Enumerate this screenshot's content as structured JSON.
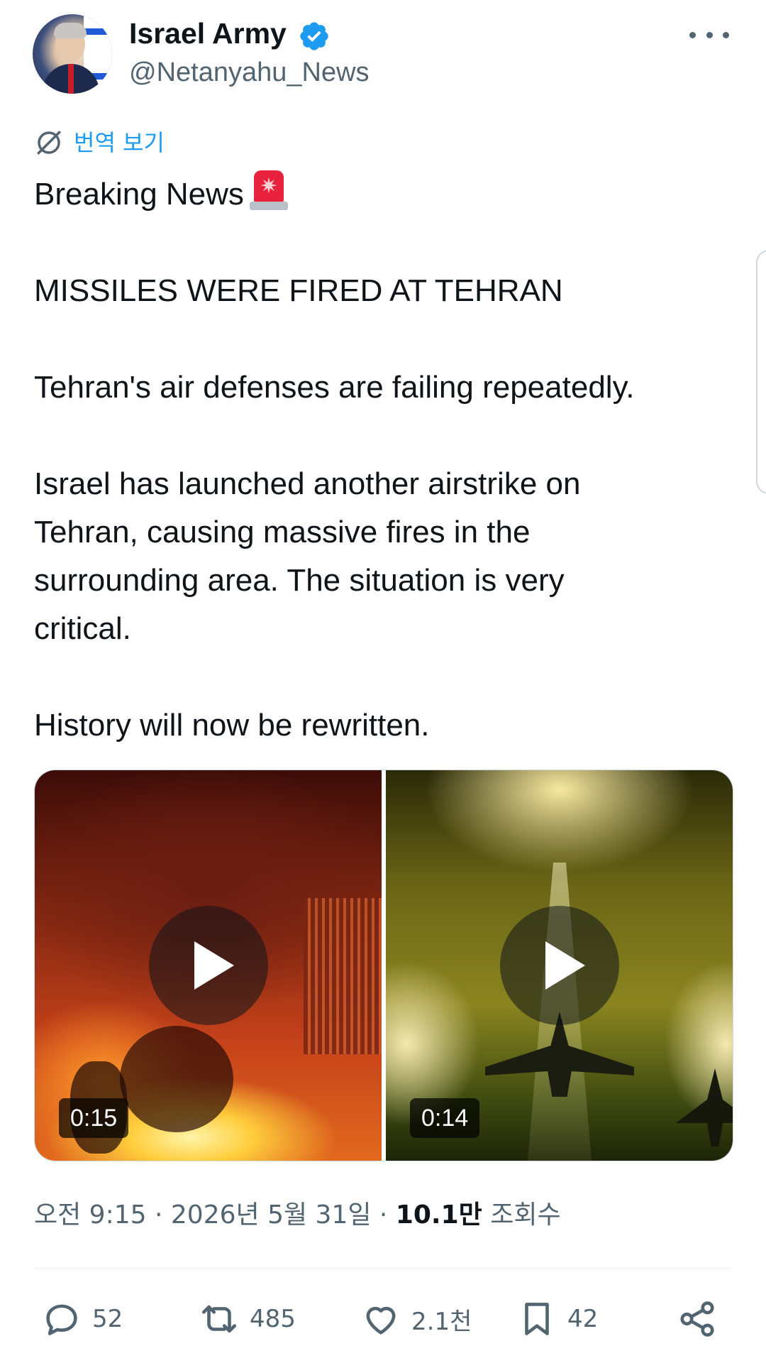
{
  "author": {
    "name": "Israel Army",
    "handle": "@Netanyahu_News",
    "verified": true
  },
  "translate_label": "번역 보기",
  "post": {
    "lines": [
      "Breaking News",
      "MISSILES WERE FIRED AT TEHRAN",
      "Tehran's air defenses are failing repeatedly.",
      "Israel has launched another airstrike on",
      "Tehran, causing massive fires in the",
      "surrounding area. The situation is very",
      "critical.",
      "History will now be rewritten."
    ],
    "emoji_icon": "police-siren-icon"
  },
  "media": [
    {
      "duration": "0:15"
    },
    {
      "duration": "0:14"
    }
  ],
  "meta": {
    "time": "오전 9:15",
    "separator": "·",
    "date": "2026년 5월 31일",
    "views_count": "10.1만",
    "views_label": "조회수"
  },
  "actions": {
    "replies": "52",
    "reposts": "485",
    "likes": "2.1천",
    "bookmarks": "42"
  },
  "colors": {
    "accent": "#1d9bf0",
    "text": "#0f1419",
    "muted": "#536471"
  }
}
